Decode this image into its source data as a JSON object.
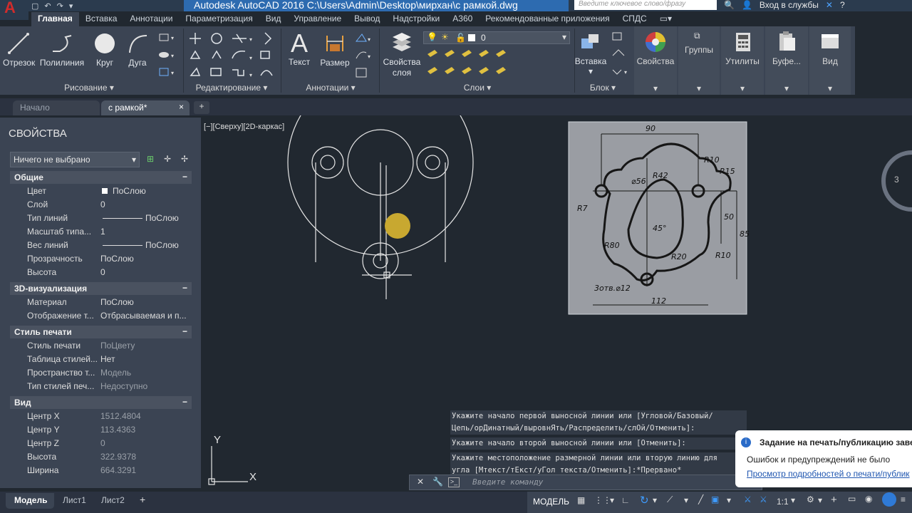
{
  "app": {
    "title": "Autodesk AutoCAD 2016    C:\\Users\\Admin\\Desktop\\мирхан\\с рамкой.dwg",
    "search_placeholder": "Введите ключевое слово/фразу",
    "signin": "Вход в службы",
    "accent": "#2d6bb0"
  },
  "ribbon_tabs": [
    "Главная",
    "Вставка",
    "Аннотации",
    "Параметризация",
    "Вид",
    "Управление",
    "Вывод",
    "Надстройки",
    "A360",
    "Рекомендованные приложения",
    "СПДС"
  ],
  "ribbon": {
    "draw": {
      "line": "Отрезок",
      "polyline": "Полилиния",
      "circle": "Круг",
      "arc": "Дуга",
      "footer": "Рисование"
    },
    "modify_footer": "Редактирование",
    "annotation": {
      "text": "Текст",
      "dimension": "Размер",
      "footer": "Аннотации"
    },
    "layers": {
      "props": "Свойства\nслоя",
      "props_l1": "Свойства",
      "props_l2": "слоя",
      "current_layer": "0",
      "footer": "Слои"
    },
    "block": {
      "insert": "Вставка",
      "footer": "Блок"
    },
    "properties": "Свойства",
    "groups": "Группы",
    "utilities": "Утилиты",
    "clipboard": "Буфе...",
    "view": "Вид"
  },
  "doc_tabs": {
    "start": "Начало",
    "active": "с рамкой*"
  },
  "viewport_label": "[−][Сверху][2D-каркас]",
  "properties_panel": {
    "title": "СВОЙСТВА",
    "selection": "Ничего не выбрано",
    "sections": {
      "general": {
        "title": "Общие",
        "rows": [
          {
            "k": "Цвет",
            "v": "ПоСлою"
          },
          {
            "k": "Слой",
            "v": "0"
          },
          {
            "k": "Тип линий",
            "v": "ПоСлою"
          },
          {
            "k": "Масштаб типа...",
            "v": "1"
          },
          {
            "k": "Вес линий",
            "v": "ПоСлою"
          },
          {
            "k": "Прозрачность",
            "v": "ПоСлою"
          },
          {
            "k": "Высота",
            "v": "0"
          }
        ]
      },
      "viz3d": {
        "title": "3D-визуализация",
        "rows": [
          {
            "k": "Материал",
            "v": "ПоСлою"
          },
          {
            "k": "Отображение т...",
            "v": "Отбрасываемая и п..."
          }
        ]
      },
      "plot": {
        "title": "Стиль печати",
        "rows": [
          {
            "k": "Стиль печати",
            "v": "ПоЦвету"
          },
          {
            "k": "Таблица стилей...",
            "v": "Нет"
          },
          {
            "k": "Пространство т...",
            "v": "Модель"
          },
          {
            "k": "Тип стилей печ...",
            "v": "Недоступно"
          }
        ]
      },
      "view": {
        "title": "Вид",
        "rows": [
          {
            "k": "Центр X",
            "v": "1512.4804"
          },
          {
            "k": "Центр Y",
            "v": "113.4363"
          },
          {
            "k": "Центр Z",
            "v": "0"
          },
          {
            "k": "Высота",
            "v": "322.9378"
          },
          {
            "k": "Ширина",
            "v": "664.3291"
          }
        ]
      }
    }
  },
  "drawing": {
    "dims": {
      "d90": "90",
      "r10a": "R10",
      "r15": "R15",
      "r42": "R42",
      "d56": "⌀56",
      "r7": "R7",
      "d50": "50",
      "d85": "85",
      "a45": "45°",
      "r80": "R80",
      "r20": "R20",
      "r10b": "R10",
      "holes": "3отв.⌀12",
      "d112": "112"
    },
    "ucs_x": "X",
    "ucs_y": "Y",
    "side_num": "3"
  },
  "command": {
    "history": [
      "Укажите начало первой выносной линии или [Угловой/Базовый/",
      "Цепь/орДинатный/выровнЯть/Распределить/слОй/Отменить]:",
      "Укажите начало второй выносной линии или [Отменить]:",
      "Укажите местоположение размерной линии или вторую линию для",
      "угла [Мтекст/тЕкст/уГол текста/Отменить]:*Прервано*"
    ],
    "placeholder": "Введите команду"
  },
  "layout_tabs": [
    "Модель",
    "Лист1",
    "Лист2"
  ],
  "status": {
    "model": "МОДЕЛЬ",
    "scale": "1:1"
  },
  "notification": {
    "title": "Задание на печать/публикацию заве",
    "body": "Ошибок и предупреждений не было",
    "link": "Просмотр подробностей о печати/публик"
  }
}
